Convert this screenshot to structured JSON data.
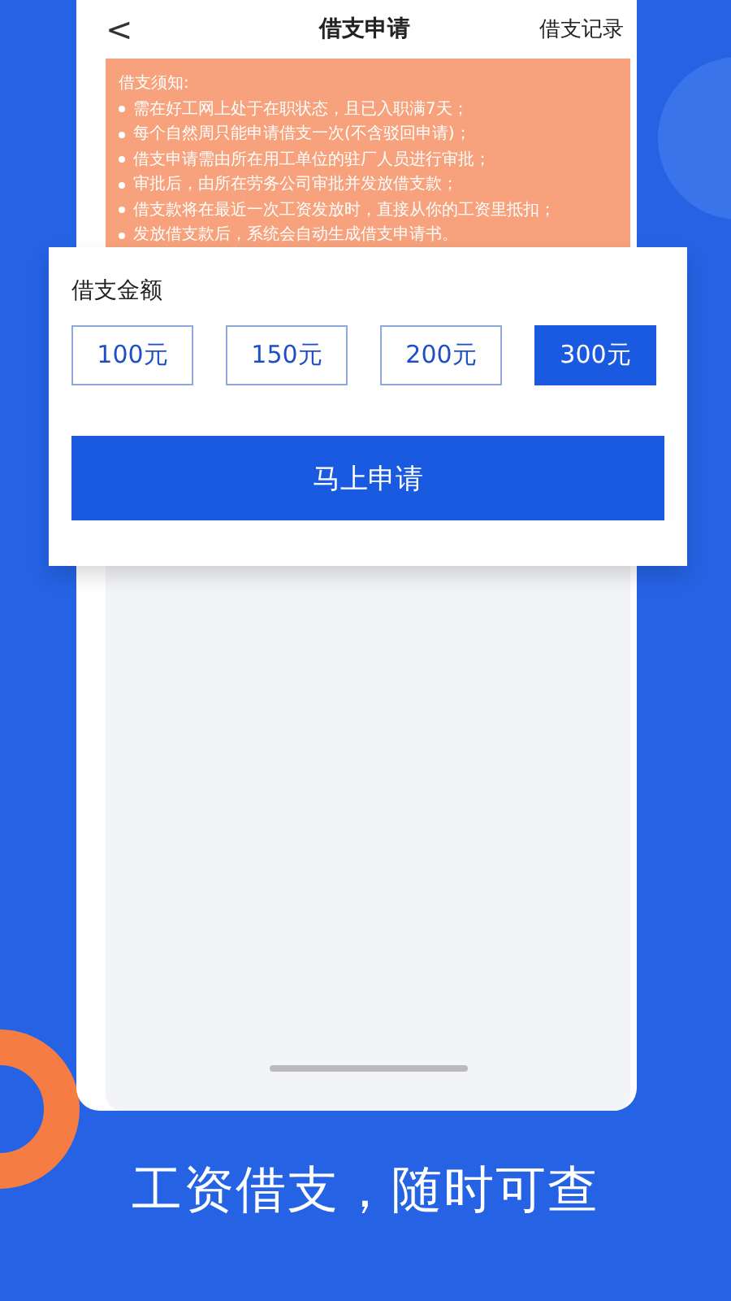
{
  "header": {
    "back": "<",
    "title": "借支申请",
    "action": "借支记录"
  },
  "notice": {
    "title": "借支须知:",
    "items": [
      "需在好工网上处于在职状态，且已入职满7天；",
      "每个自然周只能申请借支一次(不含驳回申请)；",
      "借支申请需由所在用工单位的驻厂人员进行审批；",
      "审批后，由所在劳务公司审批并发放借支款；",
      "借支款将在最近一次工资发放时，直接从你的工资里抵扣；",
      "发放借支款后，系统会自动生成借支申请书。"
    ]
  },
  "amount": {
    "label": "借支金额",
    "options": [
      {
        "label": "100元",
        "selected": false
      },
      {
        "label": "150元",
        "selected": false
      },
      {
        "label": "200元",
        "selected": false
      },
      {
        "label": "300元",
        "selected": true
      }
    ],
    "submit": "马上申请"
  },
  "caption": "工资借支，随时可查"
}
